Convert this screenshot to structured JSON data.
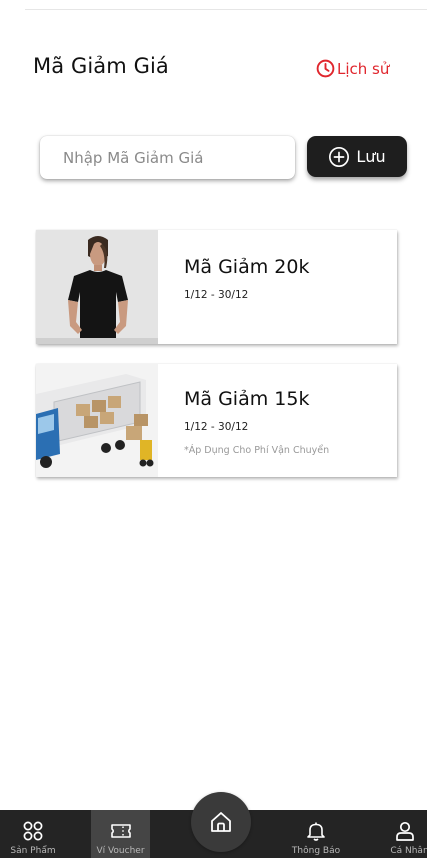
{
  "header": {
    "title": "Mã Giảm Giá",
    "history_label": "Lịch sử"
  },
  "code_entry": {
    "placeholder": "Nhập Mã Giảm Giá",
    "save_label": "Lưu"
  },
  "vouchers": [
    {
      "title": "Mã Giảm 20k",
      "dates": "1/12 - 30/12",
      "note": "",
      "image": "woman-black-tshirt-photo"
    },
    {
      "title": "Mã Giảm 15k",
      "dates": "1/12 - 30/12",
      "note": "*Áp Dụng Cho Phí Vận Chuyển",
      "image": "delivery-truck-photo"
    }
  ],
  "bottom_nav": {
    "items": [
      {
        "label": "Sản Phẩm",
        "icon": "grid-icon",
        "active": false
      },
      {
        "label": "Ví Voucher",
        "icon": "ticket-icon",
        "active": true
      },
      {
        "label": "Thông Báo",
        "icon": "bell-icon",
        "active": false
      },
      {
        "label": "Cá Nhân",
        "icon": "user-icon",
        "active": false
      }
    ],
    "home_icon": "home-icon"
  },
  "colors": {
    "accent_red": "#e0262d",
    "dark": "#1e1e1e",
    "nav_bg": "#242424",
    "nav_active_bg": "#454545"
  }
}
